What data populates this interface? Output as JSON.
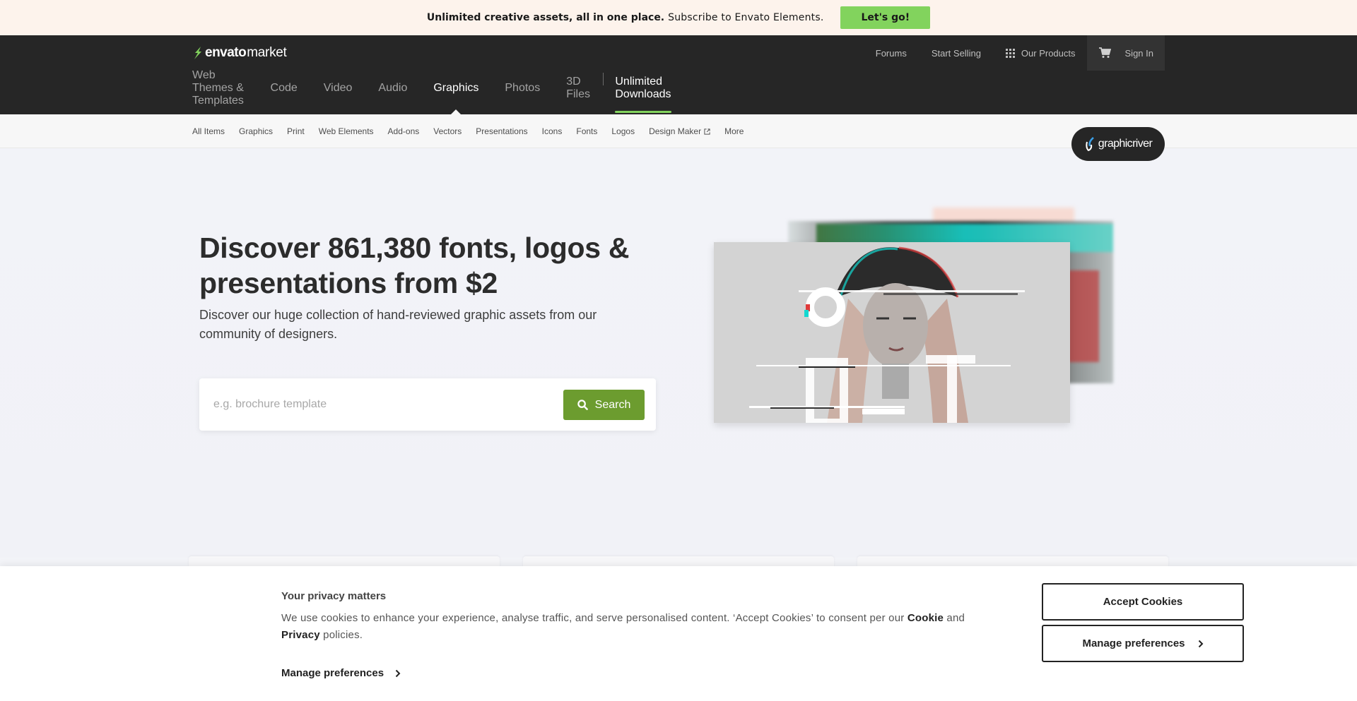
{
  "promo": {
    "bold_text": "Unlimited creative assets, all in one place.",
    "sub_text": "Subscribe to Envato Elements.",
    "cta_label": "Let's go!"
  },
  "header": {
    "logo_brand": "envato",
    "logo_market": "market",
    "top_links": [
      "Forums",
      "Start Selling",
      "Our Products"
    ],
    "sign_in": "Sign In",
    "main_nav": [
      "Web Themes & Templates",
      "Code",
      "Video",
      "Audio",
      "Graphics",
      "Photos",
      "3D Files"
    ],
    "unlimited": "Unlimited Downloads",
    "badge": "graphicriver"
  },
  "subnav": {
    "items": [
      "All Items",
      "Graphics",
      "Print",
      "Web Elements",
      "Add-ons",
      "Vectors",
      "Presentations",
      "Icons",
      "Fonts",
      "Logos",
      "Design Maker",
      "More"
    ]
  },
  "hero": {
    "title": "Discover 861,380 fonts, logos & presentations from $2",
    "description": "Discover our huge collection of hand-reviewed graphic assets from our community of designers.",
    "search_placeholder": "e.g. brochure template",
    "search_button": "Search"
  },
  "cookie": {
    "title": "Your privacy matters",
    "message_start": "We use cookies to enhance your experience, analyse traffic, and serve personalised content. ‘Accept Cookies’ to consent per our",
    "cookie_link": "Cookie",
    "and": "and",
    "privacy_link": "Privacy",
    "message_end": "policies.",
    "manage_link": "Manage preferences",
    "accept_button": "Accept Cookies",
    "manage_button": "Manage preferences"
  },
  "colors": {
    "accent_green": "#82d35d",
    "search_green": "#6c9c2f",
    "header_bg": "#262626"
  }
}
